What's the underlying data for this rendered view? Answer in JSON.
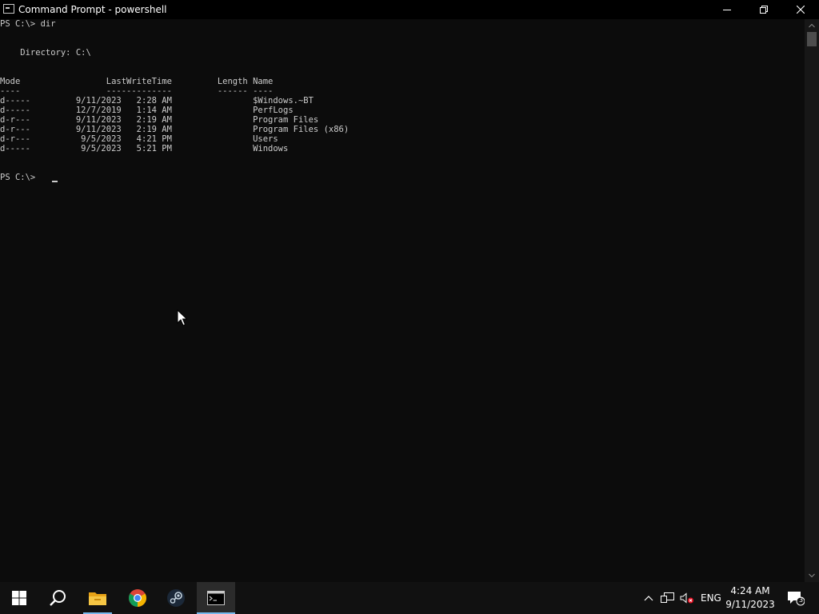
{
  "window": {
    "title": "Command Prompt - powershell"
  },
  "terminal": {
    "prompt_command": "PS C:\\> dir",
    "directory_line": "    Directory: C:\\",
    "header": "Mode                 LastWriteTime         Length Name",
    "separator": "----                 -------------         ------ ----",
    "rows": [
      "d-----         9/11/2023   2:28 AM                $Windows.~BT",
      "d-----         12/7/2019   1:14 AM                PerfLogs",
      "d-r---         9/11/2023   2:19 AM                Program Files",
      "d-r---         9/11/2023   2:19 AM                Program Files (x86)",
      "d-r---          9/5/2023   4:21 PM                Users",
      "d-----          9/5/2023   5:21 PM                Windows"
    ],
    "prompt": "PS C:\\> "
  },
  "taskbar": {
    "items": [
      "windows-start-icon",
      "search-icon",
      "file-explorer-icon",
      "chrome-icon",
      "steam-icon",
      "command-prompt-icon"
    ],
    "language": "ENG",
    "time": "4:24 AM",
    "date": "9/11/2023",
    "notification_count": "3"
  },
  "colors": {
    "terminal_bg": "#0c0c0c",
    "terminal_text": "#cccccc",
    "taskbar_bg": "#111111",
    "accent": "#76b9ed"
  }
}
